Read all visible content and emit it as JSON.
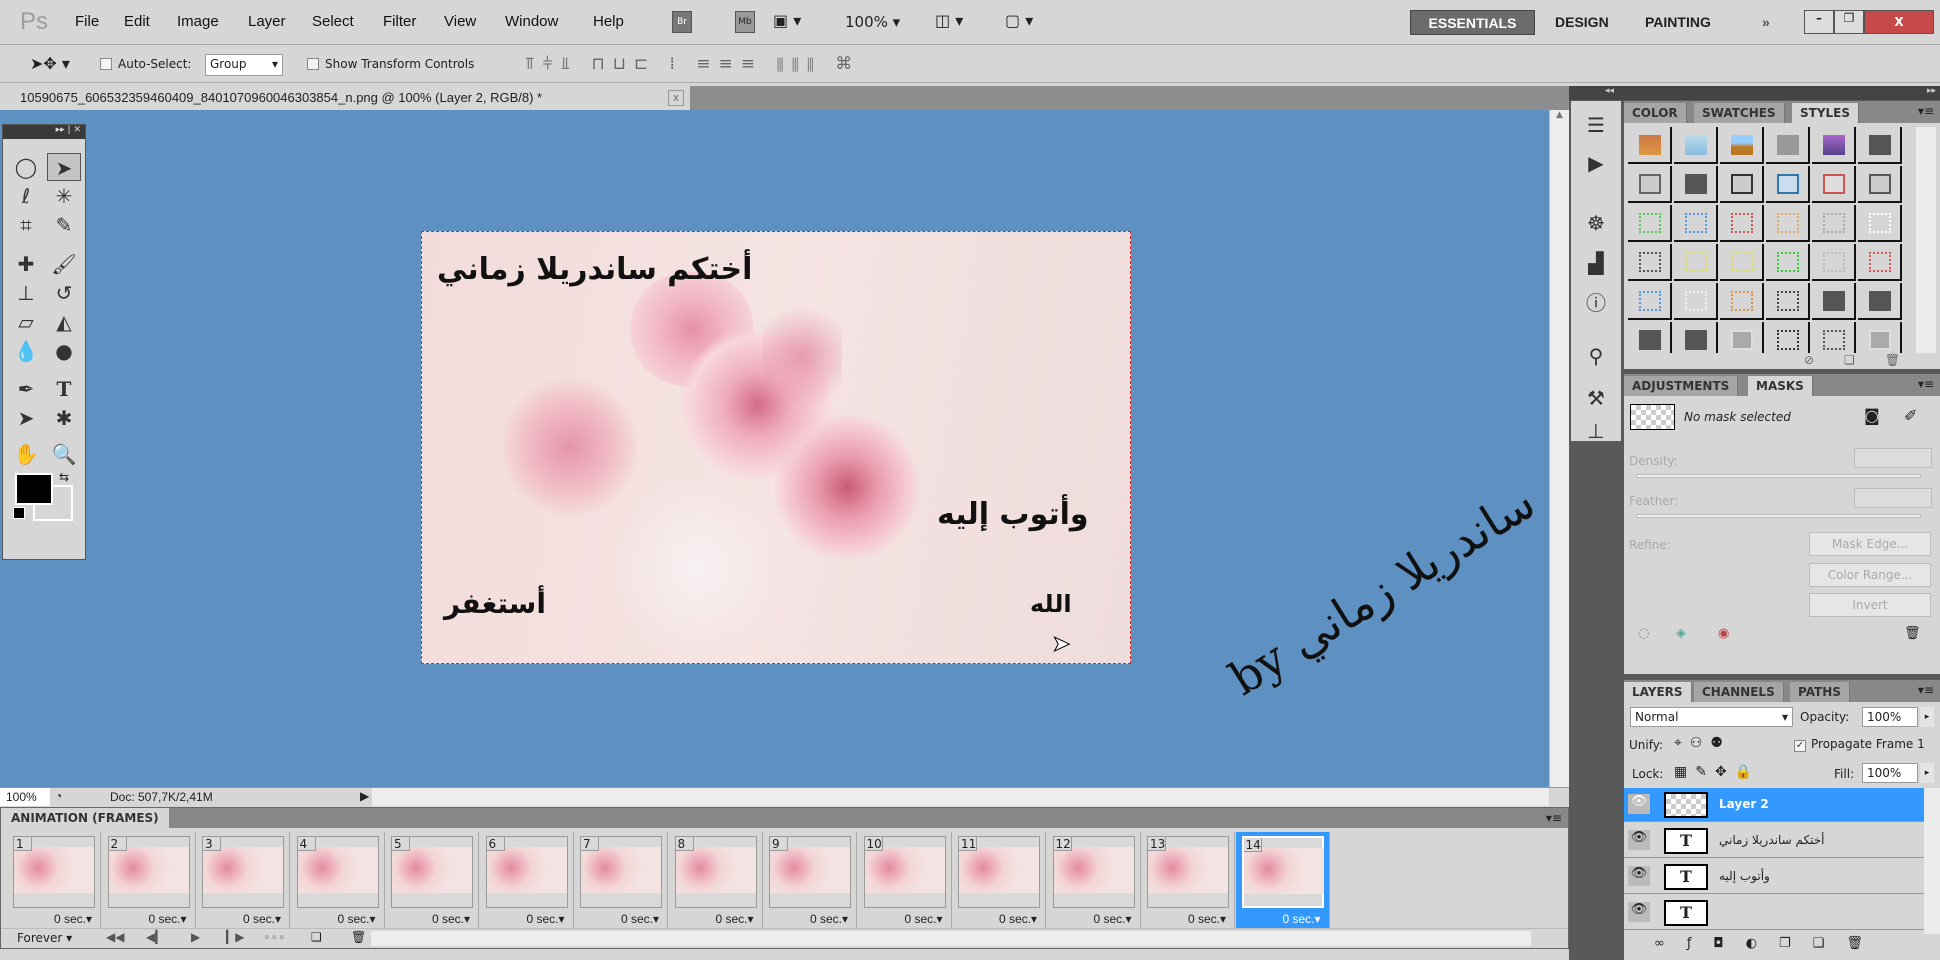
{
  "app": {
    "logo": "Ps",
    "menu": [
      "File",
      "Edit",
      "Image",
      "Layer",
      "Select",
      "Filter",
      "View",
      "Window",
      "Help"
    ],
    "bridge": "Br",
    "minibridge": "Mb",
    "zoom": "100%",
    "workspaces": [
      "ESSENTIALS",
      "DESIGN",
      "PAINTING"
    ],
    "active_workspace": "ESSENTIALS",
    "more": "»"
  },
  "options": {
    "auto_select_label": "Auto-Select:",
    "auto_select_value": "Group",
    "auto_select_checked": false,
    "transform_label": "Show Transform Controls",
    "transform_checked": false
  },
  "document": {
    "tab_title": "10590675_606532359460409_8401070960046303854_n.png @ 100% (Layer 2, RGB/8) *",
    "close": "x",
    "texts": {
      "top": "أختكم ساندريلا زماني",
      "middle": "وأتوب إليه",
      "bottom_left": "أستغفر",
      "bottom_right": "الله"
    },
    "signature": "by ساندريلا زماني"
  },
  "status": {
    "zoom": "100%",
    "doc": "Doc: 507,7K/2,41M"
  },
  "animation": {
    "title": "ANIMATION (FRAMES)",
    "loop": "Forever",
    "selected": 14,
    "frames": [
      {
        "n": "1",
        "d": "0 sec."
      },
      {
        "n": "2",
        "d": "0 sec."
      },
      {
        "n": "3",
        "d": "0 sec."
      },
      {
        "n": "4",
        "d": "0 sec."
      },
      {
        "n": "5",
        "d": "0 sec."
      },
      {
        "n": "6",
        "d": "0 sec."
      },
      {
        "n": "7",
        "d": "0 sec."
      },
      {
        "n": "8",
        "d": "0 sec."
      },
      {
        "n": "9",
        "d": "0 sec."
      },
      {
        "n": "10",
        "d": "0 sec."
      },
      {
        "n": "11",
        "d": "0 sec."
      },
      {
        "n": "12",
        "d": "0 sec."
      },
      {
        "n": "13",
        "d": "0 sec."
      },
      {
        "n": "14",
        "d": "0 sec."
      }
    ]
  },
  "styles_panel": {
    "tabs": [
      "COLOR",
      "SWATCHES",
      "STYLES"
    ],
    "active": "STYLES"
  },
  "masks_panel": {
    "tabs": [
      "ADJUSTMENTS",
      "MASKS"
    ],
    "active": "MASKS",
    "no_mask": "No mask selected",
    "density": "Density:",
    "feather": "Feather:",
    "refine": "Refine:",
    "buttons": [
      "Mask Edge...",
      "Color Range...",
      "Invert"
    ]
  },
  "layers_panel": {
    "tabs": [
      "LAYERS",
      "CHANNELS",
      "PATHS"
    ],
    "active": "LAYERS",
    "blend": "Normal",
    "opacity_label": "Opacity:",
    "opacity": "100%",
    "unify": "Unify:",
    "propagate": "Propagate Frame 1",
    "propagate_checked": true,
    "lock": "Lock:",
    "fill_label": "Fill:",
    "fill": "100%",
    "layers": [
      {
        "name": "Layer 2",
        "type": "pixel",
        "selected": true
      },
      {
        "name": "أختكم ساندريلا زماني",
        "type": "text"
      },
      {
        "name": "وأتوب إليه",
        "type": "text"
      },
      {
        "name": "",
        "type": "text"
      }
    ]
  },
  "colors": {
    "canvas_bg": "#5f90c2",
    "selection": "#3399ff",
    "foreground": "#000000",
    "background": "#d6d6d6"
  }
}
